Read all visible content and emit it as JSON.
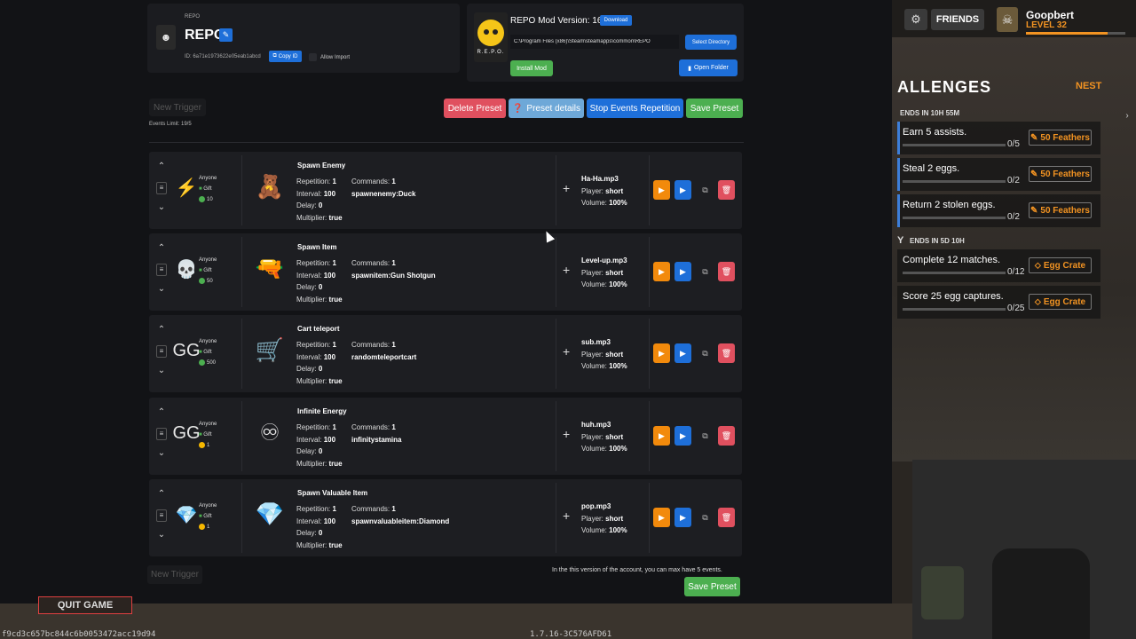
{
  "game": {
    "small_label": "REPO",
    "title": "REPO",
    "id_label": "ID: 6a71e1973622e05eab1abcd",
    "copy_label": "Copy ID",
    "allow_import_label": "Allow Import"
  },
  "mod": {
    "logo_text": "R.E.P.O.",
    "version_label": "REPO Mod Version: 16v",
    "download_label": "Download",
    "path_value": "C:\\Program Files (x86)\\Steam\\steamapps\\common\\REPO",
    "select_dir_label": "Select Directory",
    "install_label": "Install Mod",
    "open_folder_label": "Open Folder"
  },
  "toolbar": {
    "new_trigger": "New Trigger",
    "events_limit": "Events Limit: 19/5",
    "delete_preset": "Delete Preset",
    "preset_details": "Preset details",
    "stop_events": "Stop Events Repetition",
    "save_preset": "Save Preset"
  },
  "triggers": [
    {
      "who": "Anyone",
      "type": "Gift",
      "amount": "10",
      "icon": "lightning-icon",
      "glyph": "⚡",
      "coin": "green",
      "name": "Spawn Enemy",
      "image": "🧸",
      "repetition": "1",
      "interval": "100",
      "delay": "0",
      "multiplier": "true",
      "commands_count": "1",
      "command": "spawnenemy:Duck",
      "sound": "Ha-Ha.mp3",
      "player": "short",
      "volume": "100%"
    },
    {
      "who": "Anyone",
      "type": "Gift",
      "amount": "50",
      "icon": "skull-icon",
      "glyph": "💀",
      "coin": "green",
      "name": "Spawn Item",
      "image": "🔫",
      "repetition": "1",
      "interval": "100",
      "delay": "0",
      "multiplier": "true",
      "commands_count": "1",
      "command": "spawnitem:Gun Shotgun",
      "sound": "Level-up.mp3",
      "player": "short",
      "volume": "100%"
    },
    {
      "who": "Anyone",
      "type": "Gift",
      "amount": "500",
      "icon": "gg-badge-icon",
      "glyph": "GG",
      "coin": "green",
      "name": "Cart teleport",
      "image": "🛒",
      "repetition": "1",
      "interval": "100",
      "delay": "0",
      "multiplier": "true",
      "commands_count": "1",
      "command": "randomteleportcart",
      "sound": "sub.mp3",
      "player": "short",
      "volume": "100%"
    },
    {
      "who": "Anyone",
      "type": "Gift",
      "amount": "1",
      "icon": "gg-pink-icon",
      "glyph": "GG",
      "coin": "gold",
      "name": "Infinite Energy",
      "image": "♾",
      "repetition": "1",
      "interval": "100",
      "delay": "0",
      "multiplier": "true",
      "commands_count": "1",
      "command": "infinitystamina",
      "sound": "huh.mp3",
      "player": "short",
      "volume": "100%"
    },
    {
      "who": "Anyone",
      "type": "Gift",
      "amount": "1",
      "icon": "crystal-icon",
      "glyph": "💎",
      "coin": "gold",
      "name": "Spawn Valuable Item",
      "image": "💎",
      "repetition": "1",
      "interval": "100",
      "delay": "0",
      "multiplier": "true",
      "commands_count": "1",
      "command": "spawnvaluableitem:Diamond",
      "sound": "pop.mp3",
      "player": "short",
      "volume": "100%"
    }
  ],
  "labels": {
    "repetition": "Repetition:",
    "interval": "Interval:",
    "delay": "Delay:",
    "multiplier": "Multiplier:",
    "commands": "Commands:",
    "player": "Player:",
    "volume": "Volume:"
  },
  "footer": {
    "limit_note": "In the this version of the account, you can max have 5 events.",
    "save_preset": "Save Preset"
  },
  "hud": {
    "friends": "FRIENDS",
    "player_name": "Goopbert",
    "player_level": "LEVEL 32",
    "xp_fraction": 0.82,
    "challenges_title": "ALLENGES",
    "nest_label": "NEST",
    "daily_ends": "ENDS IN 10H 55M",
    "weekly_prefix": "Y",
    "weekly_ends": "ENDS IN 5D 10H",
    "challenges": [
      {
        "text": "Earn 5 assists.",
        "progress": "0/5",
        "reward": "50 Feathers",
        "fraction": 0
      },
      {
        "text": "Steal 2 eggs.",
        "progress": "0/2",
        "reward": "50 Feathers",
        "fraction": 0
      },
      {
        "text": "Return 2 stolen eggs.",
        "progress": "0/2",
        "reward": "50 Feathers",
        "fraction": 0
      },
      {
        "text": "Complete 12 matches.",
        "progress": "0/12",
        "reward": "Egg Crate",
        "fraction": 0
      },
      {
        "text": "Score 25 egg captures.",
        "progress": "0/25",
        "reward": "Egg Crate",
        "fraction": 0
      }
    ],
    "quit_label": "QUIT GAME",
    "hash": "f9cd3c657bc844c6b0053472acc19d94",
    "build": "1.7.16-3C576AFD61"
  }
}
